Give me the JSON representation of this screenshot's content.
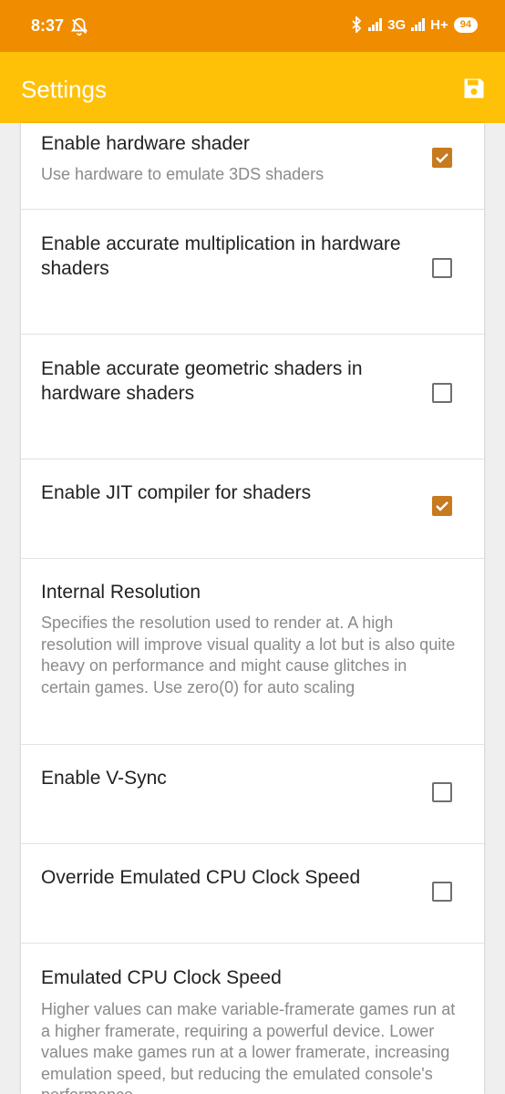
{
  "status_bar": {
    "time": "8:37",
    "network_1": "3G",
    "network_2": "H+",
    "battery": "94"
  },
  "app_bar": {
    "title": "Settings",
    "save_icon": "save-icon"
  },
  "colors": {
    "status_bar": "#F08C00",
    "app_bar": "#FFC107",
    "checkbox_checked": "#C77A1E"
  },
  "settings": [
    {
      "title": "Enable hardware shader",
      "summary": "Use hardware to emulate 3DS shaders",
      "checked": true
    },
    {
      "title": "Enable accurate multiplication in hardware shaders",
      "summary": "",
      "checked": false
    },
    {
      "title": "Enable accurate geometric shaders in hardware shaders",
      "summary": "",
      "checked": false
    },
    {
      "title": "Enable JIT compiler for shaders",
      "summary": "",
      "checked": true
    },
    {
      "title": "Internal Resolution",
      "summary": "Specifies the resolution used to render at. A high resolution will improve visual quality a lot but is also quite heavy on performance and might cause glitches in certain games. Use zero(0) for auto scaling"
    },
    {
      "title": "Enable V-Sync",
      "summary": "",
      "checked": false
    },
    {
      "title": "Override Emulated CPU Clock Speed",
      "summary": "",
      "checked": false
    },
    {
      "title": "Emulated CPU Clock Speed",
      "summary": "Higher values can make variable-framerate games run at a higher framerate, requiring a powerful device. Lower values make games run at a lower framerate, increasing emulation speed, but reducing the emulated console's performance"
    }
  ]
}
